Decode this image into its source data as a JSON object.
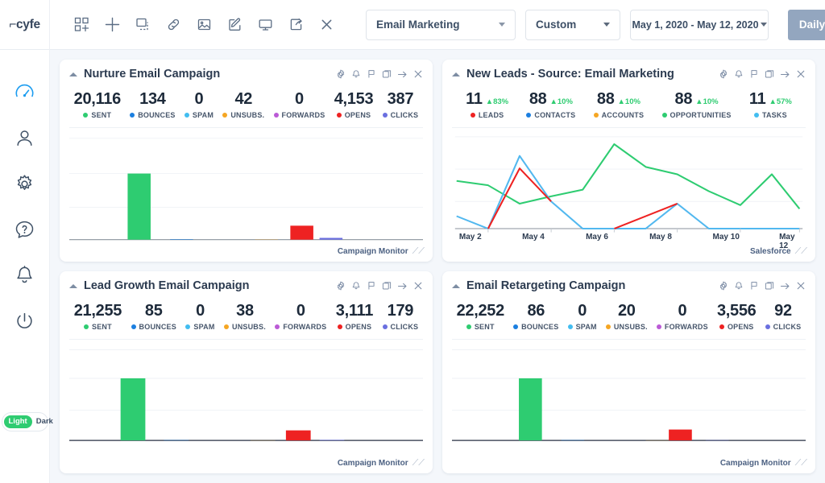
{
  "app": {
    "logo": "⌐cyfe",
    "theme_toggle": {
      "light_label": "Light",
      "dark_label": "Dark",
      "active": "Light"
    }
  },
  "toolbar": {
    "icons": [
      {
        "name": "add-widget-icon",
        "label": "Add Widget"
      },
      {
        "name": "plus-icon",
        "label": "Add"
      },
      {
        "name": "duplicate-dashed-icon",
        "label": "Copy Widget"
      },
      {
        "name": "link-icon",
        "label": "Share Link"
      },
      {
        "name": "image-icon",
        "label": "Image"
      },
      {
        "name": "edit-icon",
        "label": "Edit"
      },
      {
        "name": "monitor-icon",
        "label": "TV Mode"
      },
      {
        "name": "export-icon",
        "label": "Export"
      },
      {
        "name": "close-icon",
        "label": "Close"
      }
    ],
    "dashboard_select": "Email Marketing",
    "range_select": "Custom",
    "date_range": "May 1, 2020 - May 12, 2020",
    "interval_button": "Daily"
  },
  "sidebar": {
    "items": [
      {
        "name": "dashboard-icon",
        "label": "Dashboards",
        "active": true
      },
      {
        "name": "user-icon",
        "label": "Account",
        "active": false
      },
      {
        "name": "gear-icon",
        "label": "Settings",
        "active": false
      },
      {
        "name": "help-icon",
        "label": "Help",
        "active": false
      },
      {
        "name": "bell-icon",
        "label": "Alerts",
        "active": false
      },
      {
        "name": "power-icon",
        "label": "Logout",
        "active": false
      }
    ]
  },
  "widget_actions": [
    {
      "name": "gear-icon",
      "label": "Settings"
    },
    {
      "name": "bell-icon",
      "label": "Alerts"
    },
    {
      "name": "flag-icon",
      "label": "Goal"
    },
    {
      "name": "duplicate-icon",
      "label": "Duplicate"
    },
    {
      "name": "arrow-right-icon",
      "label": "Move"
    },
    {
      "name": "close-icon",
      "label": "Remove"
    }
  ],
  "colors": {
    "green": "#2ecc71",
    "blue": "#1b7fe0",
    "cyan": "#42bdf0",
    "orange": "#f5a623",
    "magenta": "#c martin",
    "purple": "#bb5ad6",
    "red": "#ee2222",
    "indigo": "#6a6fe0",
    "accent": "#1b9cf0",
    "daily_button": "#93a6bf"
  },
  "widgets": [
    {
      "title": "Nurture Email Campaign",
      "source": "Campaign Monitor",
      "metrics": [
        {
          "value": "20,116",
          "label": "SENT",
          "color": "#2ecc71"
        },
        {
          "value": "134",
          "label": "BOUNCES",
          "color": "#1b7fe0"
        },
        {
          "value": "0",
          "label": "SPAM",
          "color": "#42bdf0"
        },
        {
          "value": "42",
          "label": "UNSUBS.",
          "color": "#f5a623"
        },
        {
          "value": "0",
          "label": "FORWARDS",
          "color": "#bb5ad6"
        },
        {
          "value": "4,153",
          "label": "OPENS",
          "color": "#ee2222"
        },
        {
          "value": "387",
          "label": "CLICKS",
          "color": "#6a6fe0"
        }
      ],
      "chart_data": {
        "type": "bar",
        "categories": [
          "SENT",
          "BOUNCES",
          "SPAM",
          "UNSUBS.",
          "FORWARDS",
          "OPENS",
          "CLICKS"
        ],
        "values": [
          20116,
          134,
          0,
          42,
          0,
          4153,
          387
        ],
        "colors": [
          "#2ecc71",
          "#1b7fe0",
          "#42bdf0",
          "#f5a623",
          "#bb5ad6",
          "#ee2222",
          "#6a6fe0"
        ],
        "title": "Nurture Email Campaign",
        "xlabel": "",
        "ylabel": "",
        "ylim": [
          0,
          27000
        ],
        "grid": true,
        "legend": "none"
      }
    },
    {
      "title": "New Leads - Source: Email Marketing",
      "source": "Salesforce",
      "metrics": [
        {
          "value": "11",
          "delta": "▲83%",
          "label": "LEADS",
          "color": "#ee2222"
        },
        {
          "value": "88",
          "delta": "▲10%",
          "label": "CONTACTS",
          "color": "#1b7fe0"
        },
        {
          "value": "88",
          "delta": "▲10%",
          "label": "ACCOUNTS",
          "color": "#f5a623"
        },
        {
          "value": "88",
          "delta": "▲10%",
          "label": "OPPORTUNITIES",
          "color": "#2ecc71"
        },
        {
          "value": "11",
          "delta": "▲57%",
          "label": "TASKS",
          "color": "#42bdf0"
        }
      ],
      "chart_data": {
        "type": "line",
        "title": "New Leads - Source: Email Marketing",
        "x": [
          "May 1",
          "May 2",
          "May 3",
          "May 4",
          "May 5",
          "May 6",
          "May 7",
          "May 8",
          "May 9",
          "May 10",
          "May 11",
          "May 12"
        ],
        "tick_labels": [
          "May 2",
          "May 4",
          "May 6",
          "May 8",
          "May 10",
          "May 12"
        ],
        "xlabel": "",
        "ylabel": "",
        "ylim": [
          0,
          14
        ],
        "grid": true,
        "legend": "none",
        "series": [
          {
            "name": "OPPORTUNITIES",
            "color": "#2ecc71",
            "values": [
              8,
              7,
              5,
              6,
              7.5,
              12,
              9.5,
              9,
              6.5,
              5,
              9,
              4.5
            ]
          },
          {
            "name": "CONTACTS",
            "color": "#42bdf0",
            "values": [
              3,
              0,
              11,
              5,
              0,
              0,
              0,
              4.5,
              0,
              0,
              0,
              0
            ]
          },
          {
            "name": "LEADS",
            "color": "#ee2222",
            "values": [
              null,
              0,
              9.5,
              5,
              null,
              0,
              null,
              4.5,
              null,
              null,
              null,
              null
            ]
          }
        ]
      }
    },
    {
      "title": "Lead Growth Email Campaign",
      "source": "Campaign Monitor",
      "metrics": [
        {
          "value": "21,255",
          "label": "SENT",
          "color": "#2ecc71"
        },
        {
          "value": "85",
          "label": "BOUNCES",
          "color": "#1b7fe0"
        },
        {
          "value": "0",
          "label": "SPAM",
          "color": "#42bdf0"
        },
        {
          "value": "38",
          "label": "UNSUBS.",
          "color": "#f5a623"
        },
        {
          "value": "0",
          "label": "FORWARDS",
          "color": "#bb5ad6"
        },
        {
          "value": "3,111",
          "label": "OPENS",
          "color": "#ee2222"
        },
        {
          "value": "179",
          "label": "CLICKS",
          "color": "#6a6fe0"
        }
      ],
      "chart_data": {
        "type": "bar",
        "categories": [
          "SENT",
          "BOUNCES",
          "SPAM",
          "UNSUBS.",
          "FORWARDS",
          "OPENS",
          "CLICKS"
        ],
        "values": [
          21255,
          85,
          0,
          38,
          0,
          3111,
          179
        ],
        "colors": [
          "#2ecc71",
          "#1b7fe0",
          "#42bdf0",
          "#f5a623",
          "#bb5ad6",
          "#ee2222",
          "#6a6fe0"
        ],
        "title": "Lead Growth Email Campaign",
        "xlabel": "",
        "ylabel": "",
        "ylim": [
          0,
          28000
        ],
        "grid": true,
        "legend": "none"
      }
    },
    {
      "title": "Email Retargeting Campaign",
      "source": "Campaign Monitor",
      "metrics": [
        {
          "value": "22,252",
          "label": "SENT",
          "color": "#2ecc71"
        },
        {
          "value": "86",
          "label": "BOUNCES",
          "color": "#1b7fe0"
        },
        {
          "value": "0",
          "label": "SPAM",
          "color": "#42bdf0"
        },
        {
          "value": "20",
          "label": "UNSUBS.",
          "color": "#f5a623"
        },
        {
          "value": "0",
          "label": "FORWARDS",
          "color": "#bb5ad6"
        },
        {
          "value": "3,556",
          "label": "OPENS",
          "color": "#ee2222"
        },
        {
          "value": "92",
          "label": "CLICKS",
          "color": "#6a6fe0"
        }
      ],
      "chart_data": {
        "type": "bar",
        "categories": [
          "SENT",
          "BOUNCES",
          "SPAM",
          "UNSUBS.",
          "FORWARDS",
          "OPENS",
          "CLICKS"
        ],
        "values": [
          22252,
          86,
          0,
          20,
          0,
          3556,
          92
        ],
        "colors": [
          "#2ecc71",
          "#1b7fe0",
          "#42bdf0",
          "#f5a623",
          "#bb5ad6",
          "#ee2222",
          "#6a6fe0"
        ],
        "title": "Email Retargeting Campaign",
        "xlabel": "",
        "ylabel": "",
        "ylim": [
          0,
          29000
        ],
        "grid": true,
        "legend": "none"
      }
    }
  ]
}
